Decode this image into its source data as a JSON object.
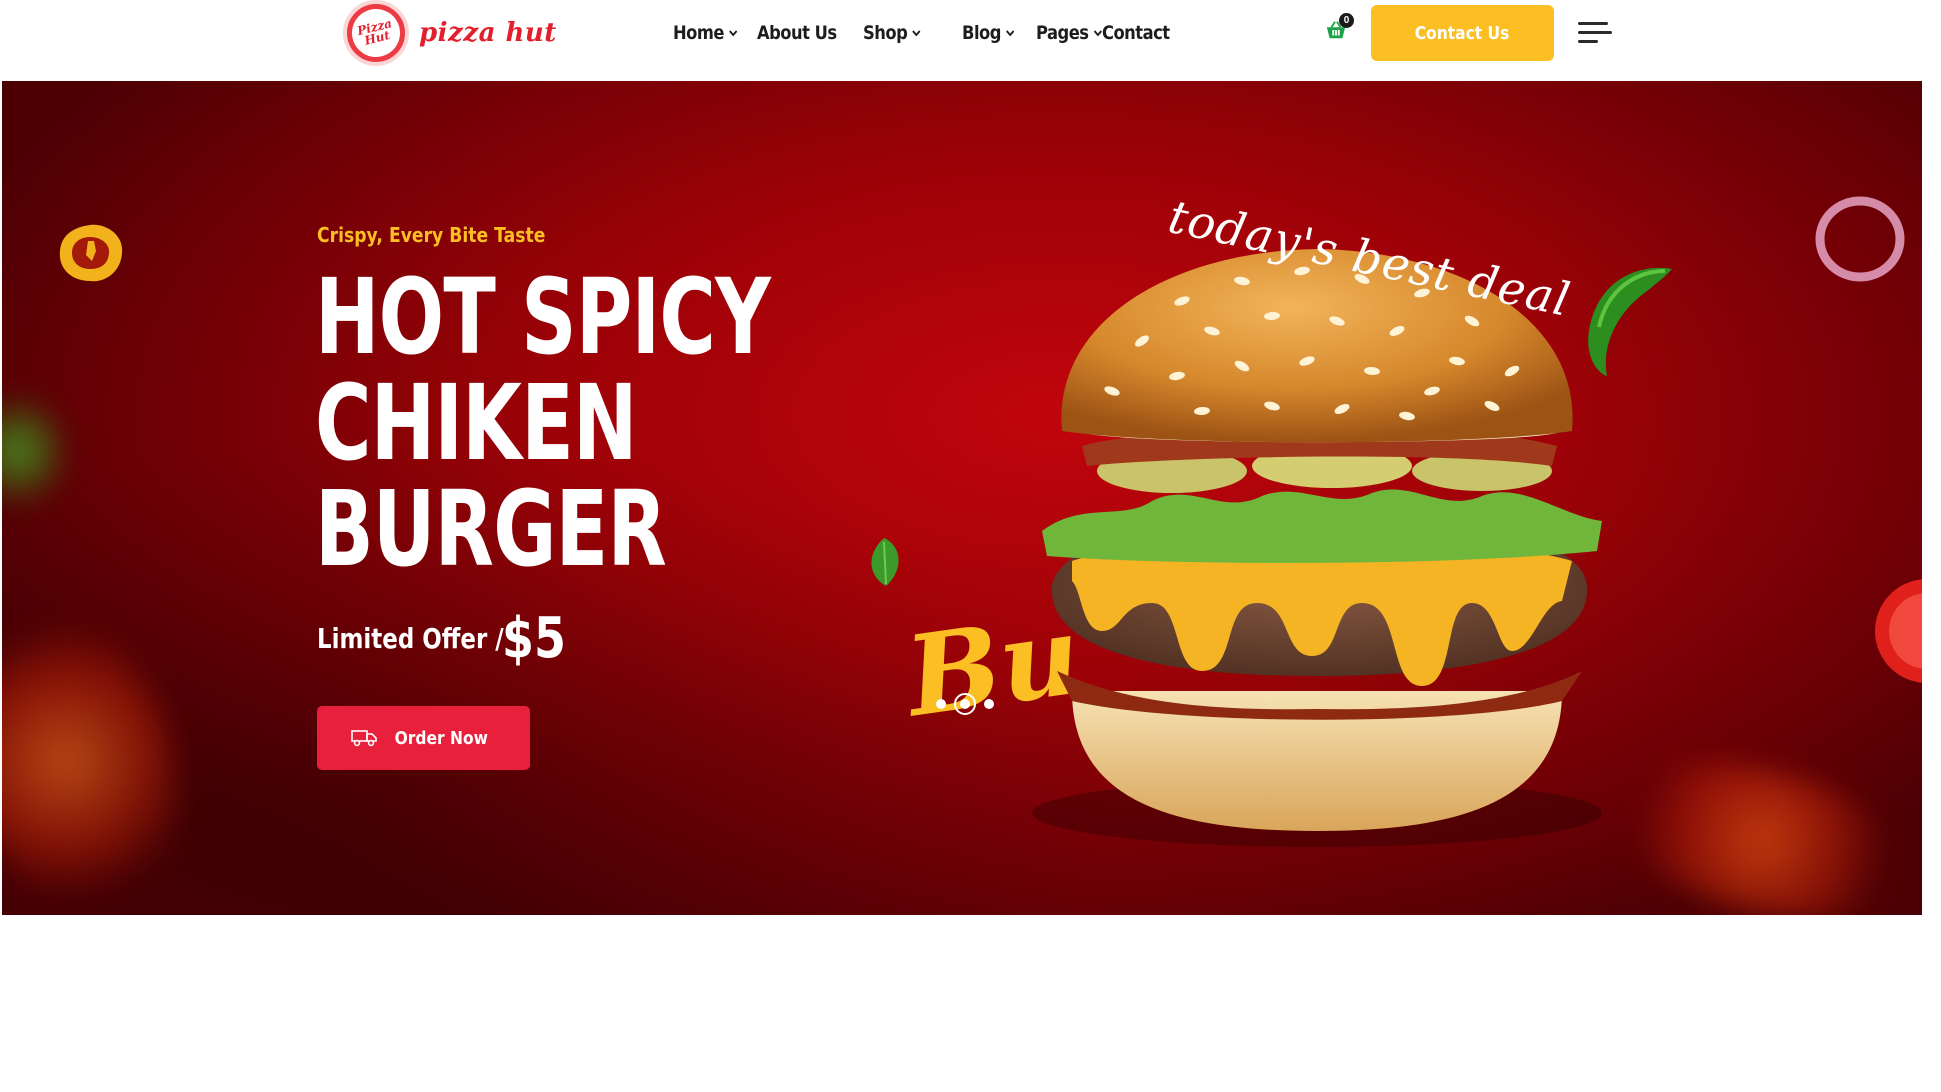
{
  "brand": {
    "name": "pizza hut",
    "badge_text": "Pizza Hut",
    "color": "#e2202d"
  },
  "nav": {
    "items": [
      {
        "label": "Home",
        "has_dropdown": true
      },
      {
        "label": "About Us",
        "has_dropdown": false
      },
      {
        "label": "Shop",
        "has_dropdown": true
      },
      {
        "label": "Blog",
        "has_dropdown": true
      },
      {
        "label": "Pages",
        "has_dropdown": true
      },
      {
        "label": "Contact",
        "has_dropdown": false
      }
    ],
    "cart_count": "0",
    "cart_icon": "basket-icon",
    "cta_label": "Contact Us",
    "cta_color": "#fbbf24",
    "menu_icon": "hamburger-icon"
  },
  "hero": {
    "eyebrow": "Crispy, Every Bite Taste",
    "headline_lines": [
      "HOT SPICY",
      "CHIKEN",
      "BURGER"
    ],
    "offer_label": "Limited Offer /",
    "offer_price": "$5",
    "order_label": "Order Now",
    "order_icon": "delivery-truck-icon",
    "order_color": "#e8203b",
    "script_text": "today's best deal",
    "bu_text": "Bu",
    "background_color": "#9b0207",
    "accent_color": "#fbbf24",
    "slider": {
      "total": 3,
      "active": 2
    }
  }
}
